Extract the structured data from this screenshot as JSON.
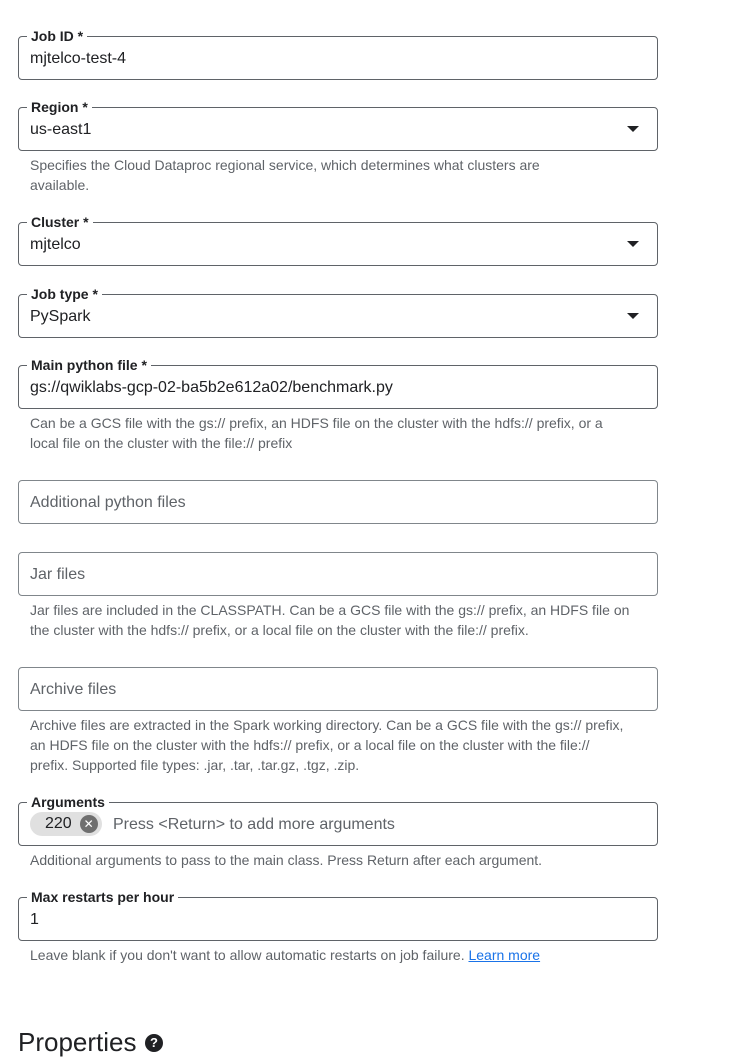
{
  "form": {
    "job_id": {
      "label": "Job ID *",
      "value": "mjtelco-test-4"
    },
    "region": {
      "label": "Region *",
      "value": "us-east1",
      "hint": "Specifies the Cloud Dataproc regional service, which determines what clusters are available."
    },
    "cluster": {
      "label": "Cluster *",
      "value": "mjtelco"
    },
    "job_type": {
      "label": "Job type *",
      "value": "PySpark"
    },
    "main_python_file": {
      "label": "Main python file *",
      "value": "gs://qwiklabs-gcp-02-ba5b2e612a02/benchmark.py",
      "hint": "Can be a GCS file with the gs:// prefix, an HDFS file on the cluster with the hdfs:// prefix, or a local file on the cluster with the file:// prefix"
    },
    "additional_python_files": {
      "placeholder": "Additional python files"
    },
    "jar_files": {
      "placeholder": "Jar files",
      "hint": "Jar files are included in the CLASSPATH. Can be a GCS file with the gs:// prefix, an HDFS file on the cluster with the hdfs:// prefix, or a local file on the cluster with the file:// prefix."
    },
    "archive_files": {
      "placeholder": "Archive files",
      "hint": "Archive files are extracted in the Spark working directory. Can be a GCS file with the gs:// prefix, an HDFS file on the cluster with the hdfs:// prefix, or a local file on the cluster with the file:// prefix. Supported file types: .jar, .tar, .tar.gz, .tgz, .zip."
    },
    "arguments": {
      "label": "Arguments",
      "chips": [
        "220"
      ],
      "placeholder": "Press <Return> to add more arguments",
      "hint": "Additional arguments to pass to the main class. Press Return after each argument."
    },
    "max_restarts": {
      "label": "Max restarts per hour",
      "value": "1",
      "hint": "Leave blank if you don't want to allow automatic restarts on job failure.",
      "learn_more": "Learn more"
    }
  },
  "properties": {
    "title": "Properties",
    "help_icon": "?"
  }
}
